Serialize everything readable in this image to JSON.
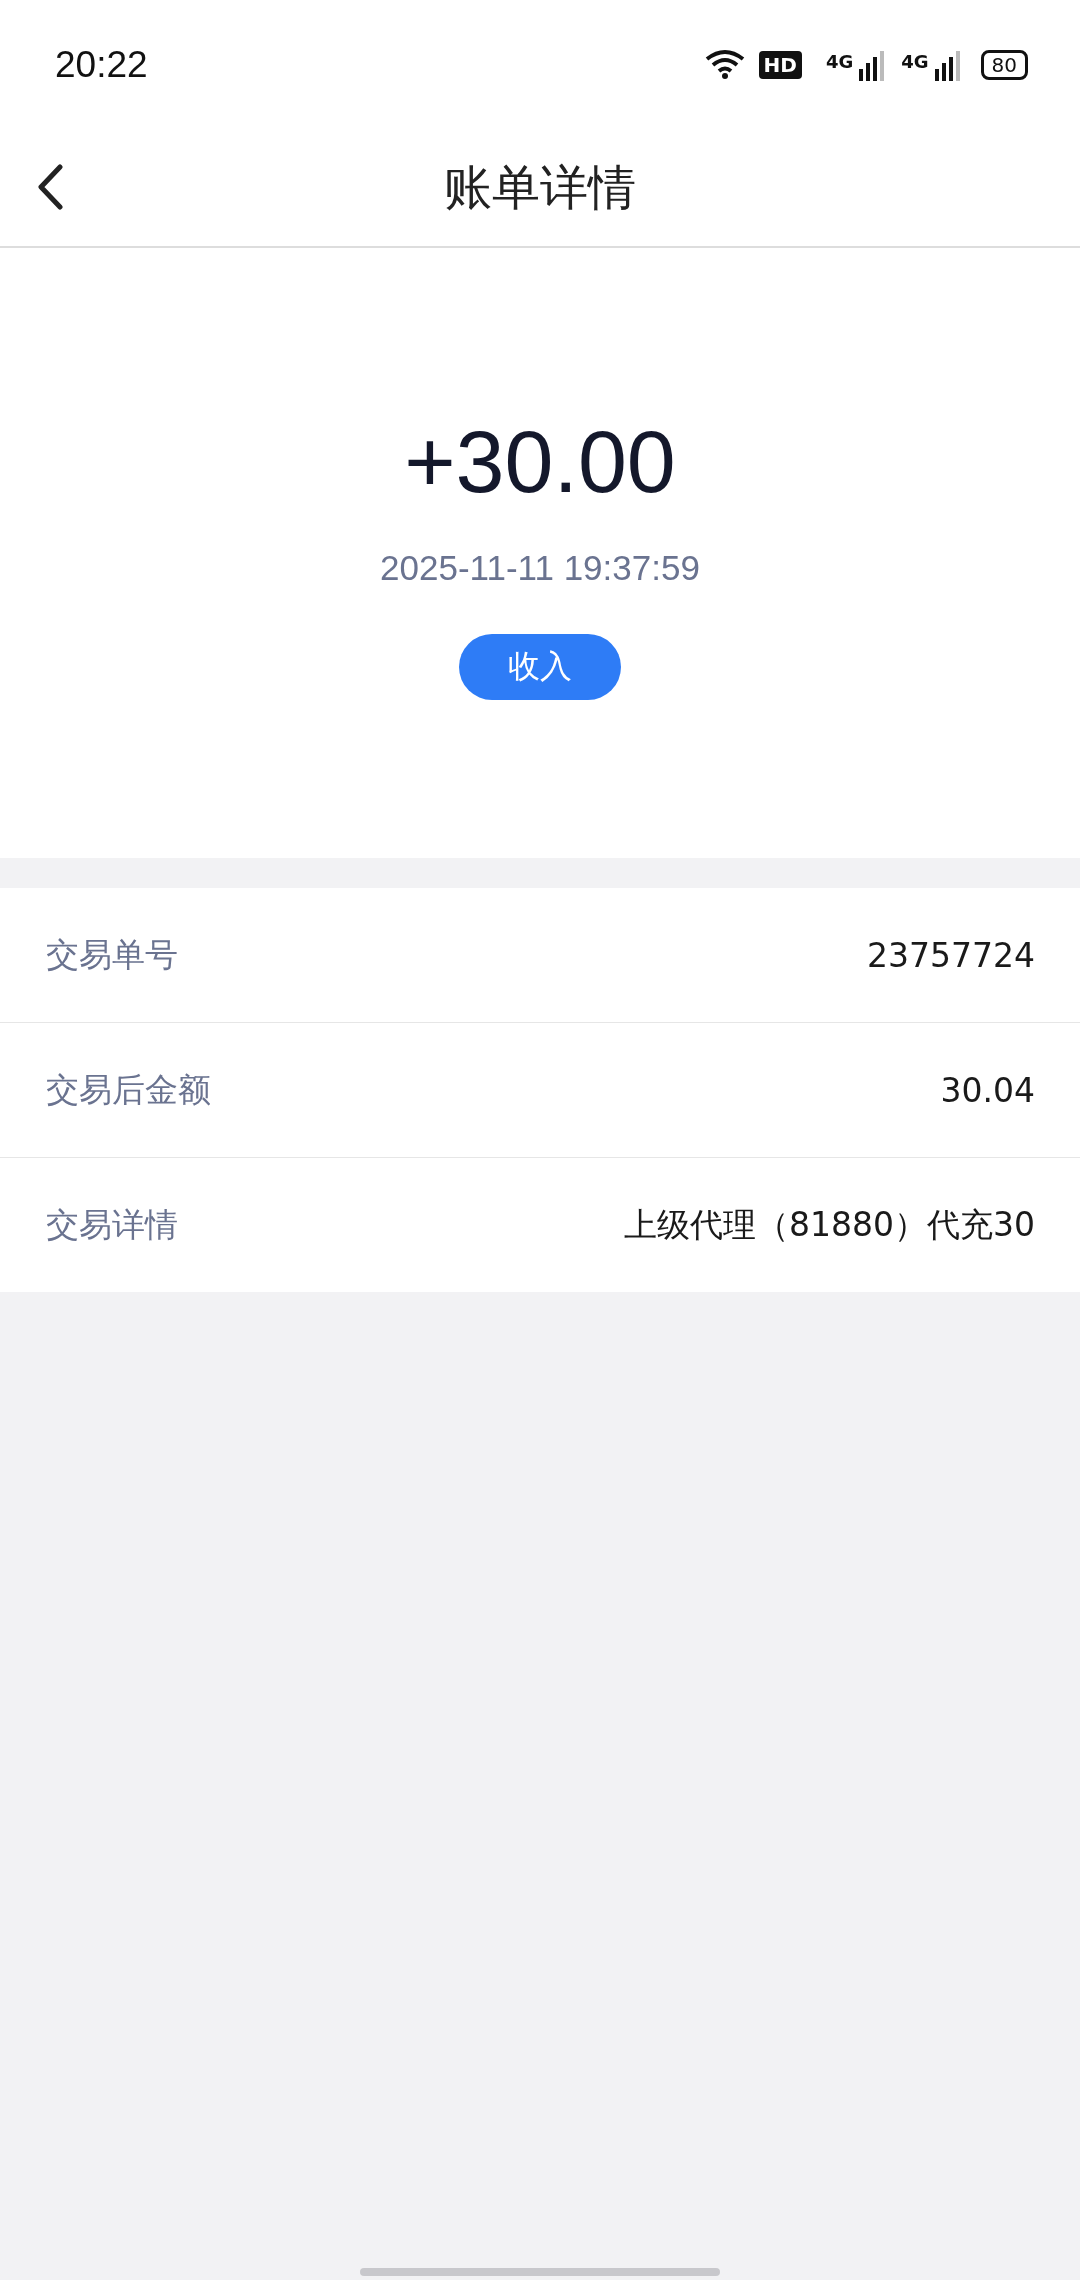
{
  "status_bar": {
    "time": "20:22",
    "hd_label": "HD",
    "networks": [
      "4G",
      "4G"
    ],
    "battery": "80"
  },
  "header": {
    "title": "账单详情"
  },
  "summary": {
    "amount": "+30.00",
    "datetime": "2025-11-11 19:37:59",
    "tag": "收入"
  },
  "details": [
    {
      "label": "交易单号",
      "value": "23757724"
    },
    {
      "label": "交易后金额",
      "value": "30.04"
    },
    {
      "label": "交易详情",
      "value": "上级代理（81880）代充30"
    }
  ]
}
